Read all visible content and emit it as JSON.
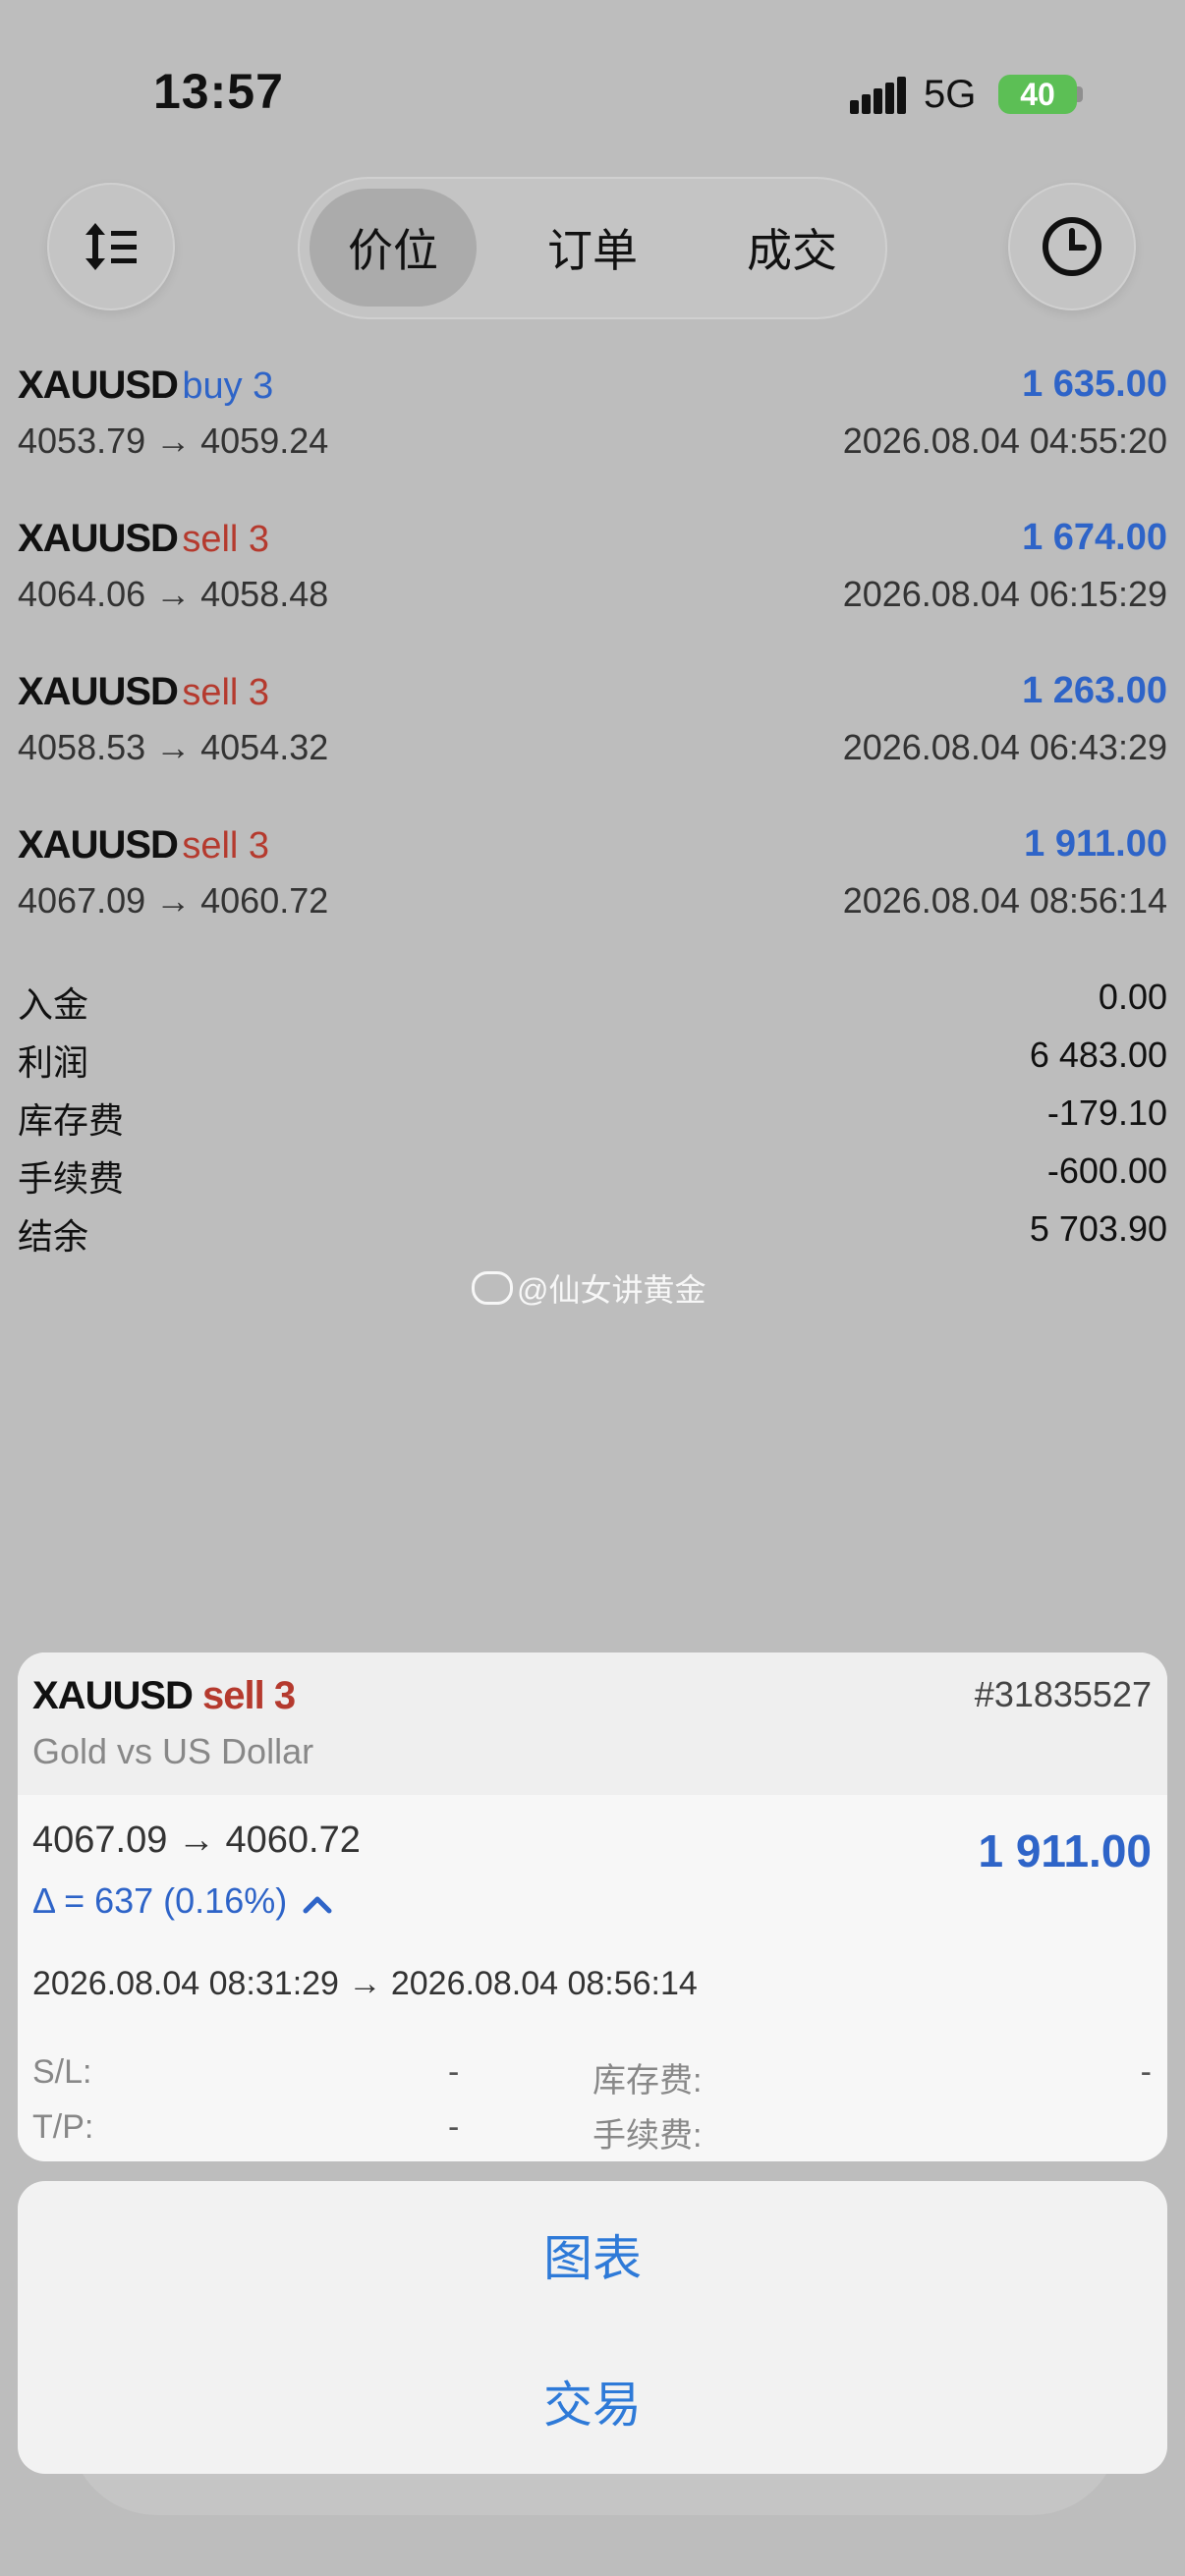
{
  "status": {
    "time": "13:57",
    "network": "5G",
    "battery": "40"
  },
  "tabs": [
    {
      "label": "价位",
      "active": true
    },
    {
      "label": "订单",
      "active": false
    },
    {
      "label": "成交",
      "active": false
    }
  ],
  "deals": [
    {
      "symbol": "XAUUSD",
      "side": "buy 3",
      "side_type": "buy",
      "profit": "1 635.00",
      "prices": "4053.79 → 4059.24",
      "datetime": "2026.08.04 04:55:20"
    },
    {
      "symbol": "XAUUSD",
      "side": "sell 3",
      "side_type": "sell",
      "profit": "1 674.00",
      "prices": "4064.06 → 4058.48",
      "datetime": "2026.08.04 06:15:29"
    },
    {
      "symbol": "XAUUSD",
      "side": "sell 3",
      "side_type": "sell",
      "profit": "1 263.00",
      "prices": "4058.53 → 4054.32",
      "datetime": "2026.08.04 06:43:29"
    },
    {
      "symbol": "XAUUSD",
      "side": "sell 3",
      "side_type": "sell",
      "profit": "1 911.00",
      "prices": "4067.09 → 4060.72",
      "datetime": "2026.08.04 08:56:14"
    }
  ],
  "summary": [
    {
      "label": "入金",
      "value": "0.00"
    },
    {
      "label": "利润",
      "value": "6 483.00"
    },
    {
      "label": "库存费",
      "value": "-179.10"
    },
    {
      "label": "手续费",
      "value": "-600.00"
    },
    {
      "label": "结余",
      "value": "5 703.90"
    }
  ],
  "watermark": "@仙女讲黄金",
  "detail": {
    "symbol": "XAUUSD",
    "side": "sell 3",
    "ticket": "#31835527",
    "description": "Gold vs US Dollar",
    "prices": "4067.09 → 4060.72",
    "profit": "1 911.00",
    "delta": "Δ = 637 (0.16%)",
    "period": "2026.08.04 08:31:29 → 2026.08.04 08:56:14",
    "sl_label": "S/L:",
    "sl_value": "-",
    "tp_label": "T/P:",
    "tp_value": "-",
    "swap_label": "库存费:",
    "swap_value": "-",
    "commission_label": "手续费:",
    "commission_value": ""
  },
  "actions": [
    "图表",
    "交易"
  ],
  "colors": {
    "accent": "#2e64c8",
    "sell": "#b53a2e",
    "battery": "#5cbf55"
  }
}
